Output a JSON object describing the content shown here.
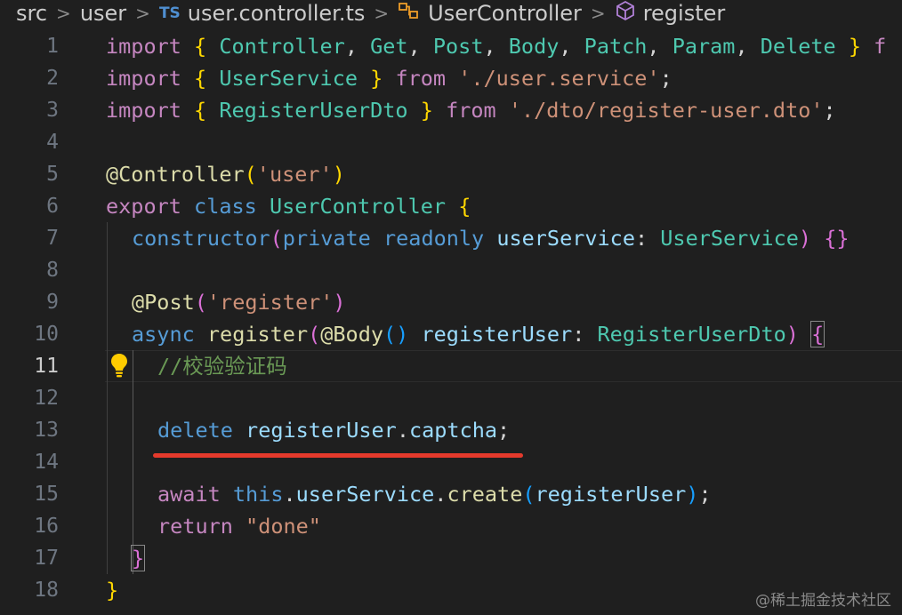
{
  "breadcrumb": {
    "items": [
      "src",
      "user",
      "user.controller.ts",
      "UserController",
      "register"
    ],
    "file_lang_badge": "TS",
    "separator": ">"
  },
  "editor": {
    "active_line": 11,
    "lines": [
      {
        "num": "1"
      },
      {
        "num": "2"
      },
      {
        "num": "3"
      },
      {
        "num": "4"
      },
      {
        "num": "5"
      },
      {
        "num": "6"
      },
      {
        "num": "7"
      },
      {
        "num": "8"
      },
      {
        "num": "9"
      },
      {
        "num": "10"
      },
      {
        "num": "11"
      },
      {
        "num": "12"
      },
      {
        "num": "13"
      },
      {
        "num": "14"
      },
      {
        "num": "15"
      },
      {
        "num": "16"
      },
      {
        "num": "17"
      },
      {
        "num": "18"
      }
    ],
    "code": {
      "l1": [
        "import",
        "{",
        "Controller",
        ", ",
        "Get",
        ", ",
        "Post",
        ", ",
        "Body",
        ", ",
        "Patch",
        ", ",
        "Param",
        ", ",
        "Delete",
        "}",
        "f"
      ],
      "l2": [
        "import",
        "{",
        "UserService",
        "}",
        "from",
        "'./user.service'",
        ";"
      ],
      "l3": [
        "import",
        "{",
        "RegisterUserDto",
        "}",
        "from",
        "'./dto/register-user.dto'",
        ";"
      ],
      "l5": [
        "@",
        "Controller",
        "(",
        "'user'",
        ")"
      ],
      "l6": [
        "export",
        "class",
        "UserController",
        "{"
      ],
      "l7": [
        "constructor",
        "(",
        "private",
        "readonly",
        "userService",
        ": ",
        "UserService",
        ")",
        "{}"
      ],
      "l9": [
        "@",
        "Post",
        "(",
        "'register'",
        ")"
      ],
      "l10": [
        "async",
        "register",
        "(",
        "@",
        "Body",
        "()",
        "registerUser",
        ": ",
        "RegisterUserDto",
        ")",
        "{"
      ],
      "l11": [
        "//校验验证码"
      ],
      "l13": [
        "delete",
        "registerUser",
        ".",
        "captcha",
        ";"
      ],
      "l15": [
        "await",
        "this",
        ".",
        "userService",
        ".",
        "create",
        "(",
        "registerUser",
        ")",
        ";"
      ],
      "l16": [
        "return",
        "\"done\""
      ],
      "l17": [
        "}"
      ],
      "l18": [
        "}"
      ]
    },
    "icons": {
      "code_action": "lightbulb-icon"
    },
    "accent_colors": {
      "underline": "#e43a2c",
      "lightbulb": "#ffcc00"
    }
  },
  "watermark": "@稀土掘金技术社区"
}
